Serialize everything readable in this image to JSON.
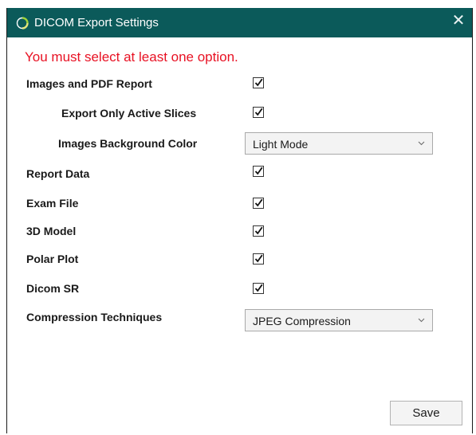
{
  "window": {
    "title": "DICOM Export Settings",
    "close_glyph": "✕",
    "icon": "app-ring-icon",
    "titlebar_color": "#0b5a5a"
  },
  "error_message": "You must select at least one option.",
  "options": [
    {
      "label": "Images and PDF Report",
      "checked": true
    },
    {
      "label": "Export Only Active Slices",
      "checked": true
    },
    {
      "label": "Images Background Color",
      "select": "Light Mode"
    },
    {
      "label": "Report Data",
      "checked": true
    },
    {
      "label": "Exam File",
      "checked": true
    },
    {
      "label": "3D Model",
      "checked": true
    },
    {
      "label": "Polar Plot",
      "checked": true
    },
    {
      "label": "Dicom SR",
      "checked": true
    },
    {
      "label": "Compression Techniques",
      "select": "JPEG Compression"
    }
  ],
  "save_label": "Save",
  "colors": {
    "error": "#e81123",
    "titlebar": "#0b5a5a"
  }
}
